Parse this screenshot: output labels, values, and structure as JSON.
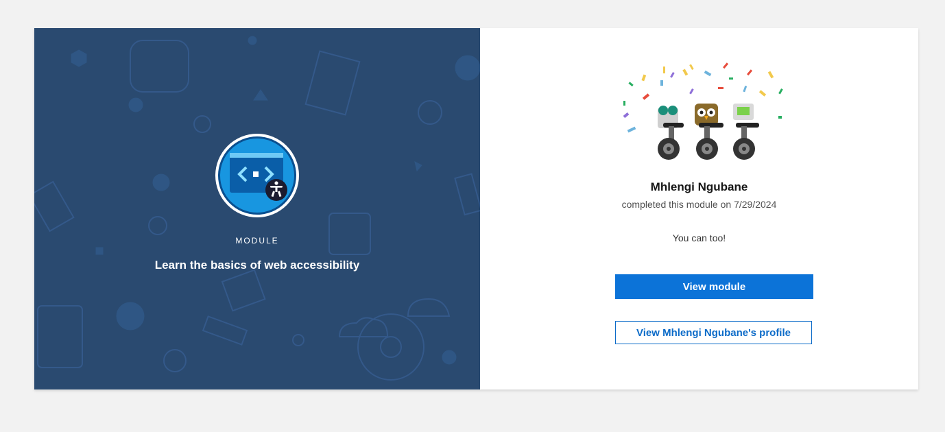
{
  "module": {
    "label": "MODULE",
    "title": "Learn the basics of web accessibility"
  },
  "achievement": {
    "user_name": "Mhlengi Ngubane",
    "completed_text": "completed this module on 7/29/2024",
    "encouragement": "You can too!"
  },
  "actions": {
    "view_module_label": "View module",
    "view_profile_label": "View Mhlengi Ngubane's profile"
  },
  "colors": {
    "left_panel": "#2a4a70",
    "primary_button": "#0c73d8",
    "link_blue": "#0c6bc8"
  }
}
